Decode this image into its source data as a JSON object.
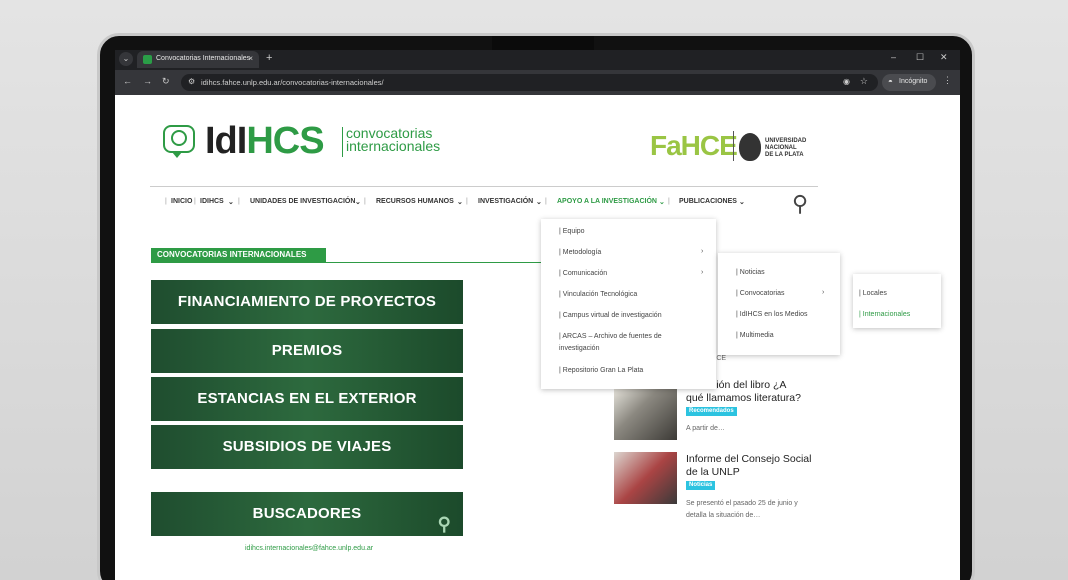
{
  "browser": {
    "tab_title": "Convocatorias Internacionales",
    "tab_close": "×",
    "new_tab": "+",
    "url": "idihcs.fahce.unlp.edu.ar/convocatorias-internacionales/",
    "incognito_label": "Incógnito",
    "window_controls": [
      "–",
      "☐",
      "✕"
    ]
  },
  "header": {
    "logo_idl": "IdI",
    "logo_hcs": "HCS",
    "logo_sub_line1": "convocatorias",
    "logo_sub_line2": "internacionales",
    "fahce": "FaHCE",
    "unlp_lines": [
      "UNIVERSIDAD",
      "NACIONAL",
      "DE LA PLATA"
    ]
  },
  "menu": {
    "items": [
      "INICIO",
      "IDIHCS",
      "UNIDADES DE INVESTIGACIÓN",
      "RECURSOS HUMANOS",
      "INVESTIGACIÓN",
      "APOYO A LA INVESTIGACIÓN",
      "PUBLICACIONES"
    ],
    "active_index": 5
  },
  "section": {
    "title": "CONVOCATORIAS INTERNACIONALES"
  },
  "banners": [
    "FINANCIAMIENTO DE PROYECTOS",
    "PREMIOS",
    "ESTANCIAS EN EL EXTERIOR",
    "SUBSIDIOS DE VIAJES",
    "BUSCADORES"
  ],
  "contact_email": "idihcs.internacionales@fahce.unlp.edu.ar",
  "dropdown_1": [
    "| Equipo",
    "| Metodología",
    "| Comunicación",
    "| Vinculación Tecnológica",
    "| Campus virtual de investigación",
    "| ARCAS – Archivo de fuentes de",
    "investigación",
    "| Repositorio Gran La Plata"
  ],
  "dropdown_2": [
    "| Noticias",
    "| Convocatorias",
    "| IdIHCS en los Medios",
    "| Multimedia"
  ],
  "dropdown_3": [
    "| Locales",
    "| Internacionales"
  ],
  "news": {
    "partial_text": "de la FaHCE",
    "items": [
      {
        "title_line1": "…ntación del libro ¿A",
        "title_line2": "qué llamamos literatura?",
        "badge": "Recomendados",
        "excerpt_line1": "A partir de…",
        "excerpt_line2": ""
      },
      {
        "title_line1": "Informe del Consejo Social",
        "title_line2": "de la UNLP",
        "badge": "Noticias",
        "excerpt_line1": "Se presentó el pasado 25 de junio y",
        "excerpt_line2": "detalla la situación de…"
      }
    ]
  },
  "colors": {
    "brand_green": "#2e9b45",
    "badge_cyan": "#2cc3e0",
    "fahce_green": "#9ac544"
  }
}
